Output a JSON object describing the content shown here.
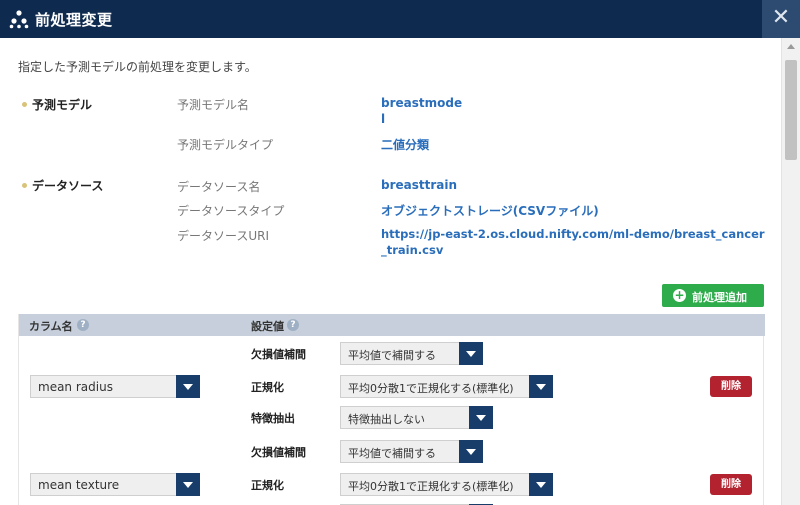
{
  "window": {
    "title": "前処理変更",
    "close_symbol": "✕",
    "logo_icon": "app-logo-icon"
  },
  "intro": "指定した予測モデルの前処理を変更します。",
  "model_section": {
    "label": "予測モデル",
    "name_label": "予測モデル名",
    "name_value_line1": "breastmode",
    "name_value_line2": "l",
    "type_label": "予測モデルタイプ",
    "type_value": "二値分類"
  },
  "datasource_section": {
    "label": "データソース",
    "name_label": "データソース名",
    "name_value": "breasttrain",
    "type_label": "データソースタイプ",
    "type_value": "オブジェクトストレージ(CSVファイル)",
    "uri_label": "データソースURI",
    "uri_value_line1": "https://jp-east-2.os.cloud.nifty.com/ml-demo/breast_cancer",
    "uri_value_line2": "_train.csv"
  },
  "add_button": {
    "label": "前処理追加",
    "icon": "plus-circle-icon"
  },
  "grid": {
    "col_column": "カラム名",
    "col_settings": "設定値",
    "help_symbol": "?",
    "rows": [
      {
        "column": "mean radius",
        "missing_label": "欠損値補間",
        "missing_value": "平均値で補間する",
        "normalize_label": "正規化",
        "normalize_value": "平均0分散1で正規化する(標準化)",
        "feature_label": "特徴抽出",
        "feature_value": "特徴抽出しない",
        "delete_label": "削除"
      },
      {
        "column": "mean texture",
        "missing_label": "欠損値補間",
        "missing_value": "平均値で補間する",
        "normalize_label": "正規化",
        "normalize_value": "平均0分散1で正規化する(標準化)",
        "delete_label": "削除"
      }
    ]
  },
  "colors": {
    "titlebar": "#0f2a4f",
    "accent_link": "#2a6ebb",
    "add_button": "#2eab4a",
    "delete_button": "#b3222f",
    "select_arrow": "#183d6b",
    "grid_header": "#c6cfdb"
  }
}
